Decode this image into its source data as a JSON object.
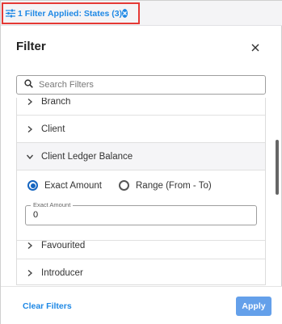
{
  "chip": {
    "label": "1 Filter Applied: States (3)",
    "icon": "filter-sliders-icon",
    "close_icon": "close-circle-icon"
  },
  "header": {
    "title": "Filter",
    "close_icon": "close-icon"
  },
  "search": {
    "placeholder": "Search Filters",
    "value": "",
    "icon": "search-icon"
  },
  "list": {
    "items": [
      {
        "label": "Branch",
        "expanded": false
      },
      {
        "label": "Client",
        "expanded": false
      },
      {
        "label": "Client Ledger Balance",
        "expanded": true
      },
      {
        "label": "Favourited",
        "expanded": false
      },
      {
        "label": "Introducer",
        "expanded": false
      }
    ],
    "ledger": {
      "options": [
        {
          "label": "Exact Amount",
          "selected": true
        },
        {
          "label": "Range (From - To)",
          "selected": false
        }
      ],
      "field_label": "Exact Amount",
      "field_value": "0"
    }
  },
  "footer": {
    "clear_label": "Clear Filters",
    "apply_label": "Apply"
  },
  "colors": {
    "accent": "#1e88e5",
    "highlight_border": "#e53935",
    "apply_bg": "#64a0ea"
  }
}
